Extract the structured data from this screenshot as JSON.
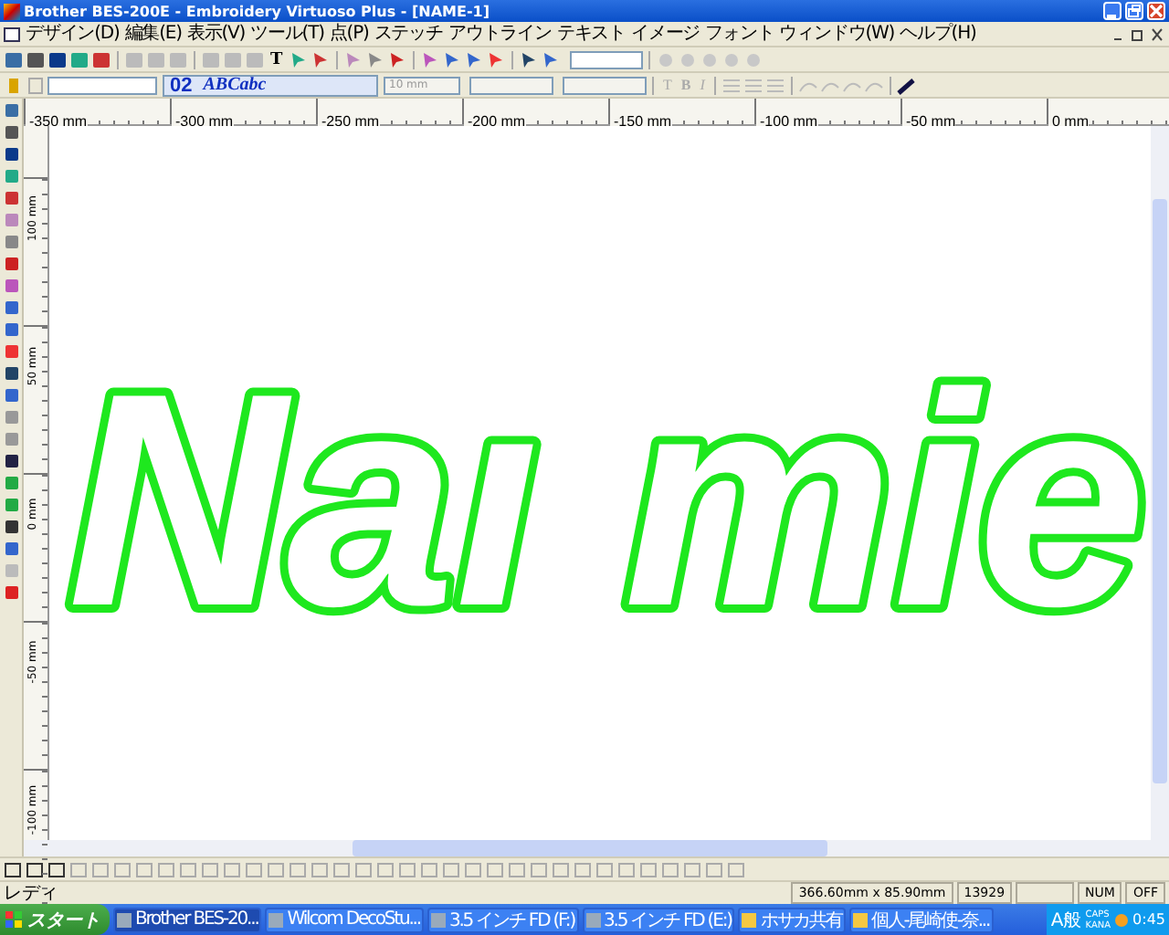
{
  "window": {
    "title": "Brother BES-200E - Embroidery Virtuoso Plus - [NAME-1]"
  },
  "menu": [
    "デザイン(D)",
    "編集(E)",
    "表示(V)",
    "ツール(T)",
    "点(P)",
    "ステッチ",
    "アウトライン",
    "テキスト",
    "イメージ",
    "フォント",
    "ウィンドウ(W)",
    "ヘルプ(H)"
  ],
  "toolbar": {
    "text_tool": "T",
    "font_number": "02",
    "font_sample": "ABCabc",
    "size": "10 mm",
    "format_buttons": [
      "T",
      "B",
      "I"
    ]
  },
  "rulers": {
    "horizontal": [
      "-350 mm",
      "-300 mm",
      "-250 mm",
      "-200 mm",
      "-150 mm",
      "-100 mm",
      "-50 mm",
      "0 mm"
    ],
    "vertical": [
      "100 mm",
      "50 mm",
      "0 mm",
      "-50 mm",
      "-100 mm"
    ]
  },
  "canvas": {
    "design_text": "Naı mie"
  },
  "status_bar": {
    "message": "レディ",
    "dimensions": "366.60mm x 85.90mm",
    "stitch_count": "13929",
    "indicators": [
      "NUM",
      "OFF"
    ]
  },
  "taskbar": {
    "start": "スタート",
    "buttons": [
      {
        "label": "Brother BES-20...",
        "selected": true
      },
      {
        "label": "Wilcom DecoStu...",
        "selected": false
      },
      {
        "label": "3.5 インチ FD (F:)",
        "selected": false
      },
      {
        "label": "3.5 インチ FD (E:)",
        "selected": false
      },
      {
        "label": "ホサカ共有",
        "selected": false
      },
      {
        "label": "個人-尾崎使-奈...",
        "selected": false
      }
    ],
    "ime": "A般",
    "tray_labels": [
      "CAPS",
      "KANA"
    ],
    "clock": "0:45"
  }
}
